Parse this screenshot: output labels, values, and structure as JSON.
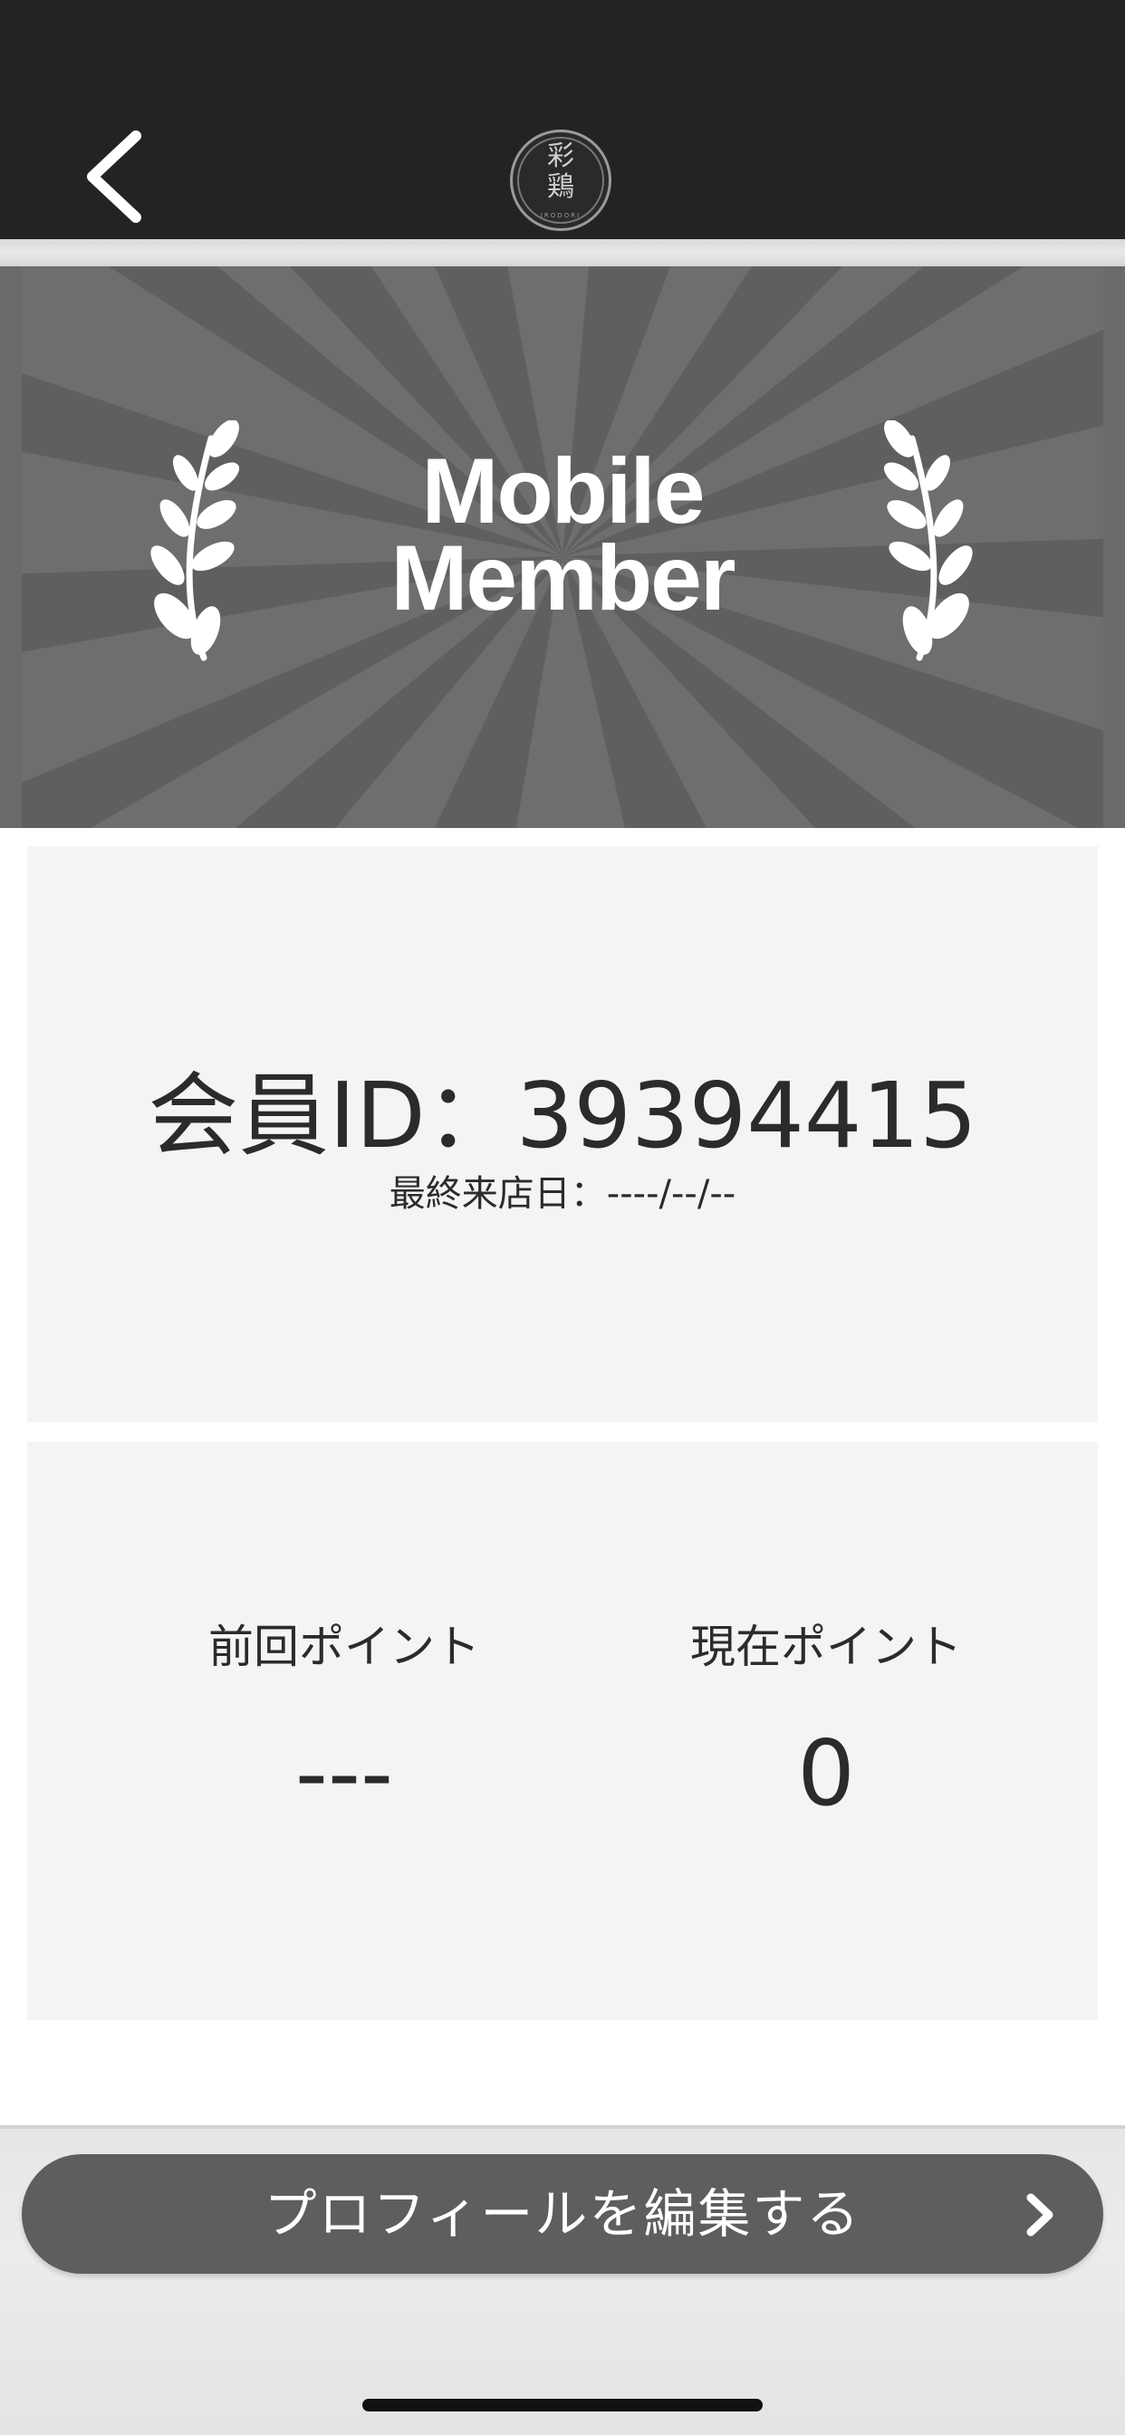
{
  "header": {
    "back_icon": "chevron-left-icon",
    "logo_line1": "彩",
    "logo_line2": "鶏",
    "logo_sub": "IRODORI"
  },
  "banner": {
    "title_line1": "Mobile",
    "title_line2": "Member",
    "decoration_icon": "laurel-branch-icon"
  },
  "member": {
    "id_text": "会員ID：39394415",
    "last_visit_text": "最終来店日：----/--/--"
  },
  "points": {
    "previous_label": "前回ポイント",
    "previous_value": "---",
    "current_label": "現在ポイント",
    "current_value": "0"
  },
  "footer": {
    "edit_profile_label": "プロフィールを編集する",
    "edit_profile_icon": "chevron-right-icon"
  },
  "colors": {
    "navbar": "#232323",
    "banner_base": "#6e6e6e",
    "card": "#f4f4f4",
    "button": "#5e5e5e",
    "text": "#2b2b2b"
  }
}
